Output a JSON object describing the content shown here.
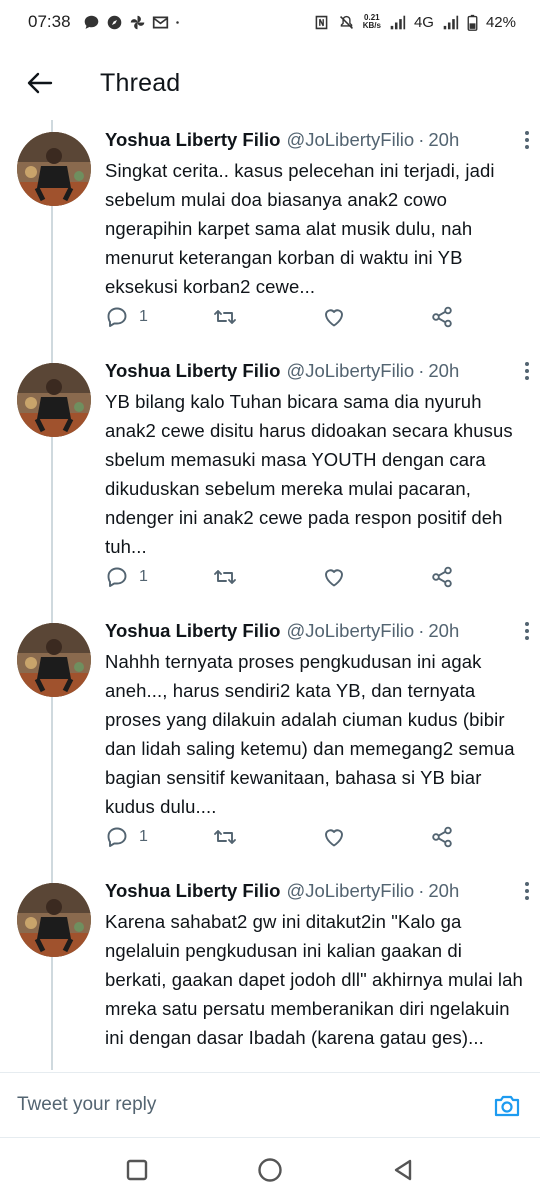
{
  "status_bar": {
    "time": "07:38",
    "net_speed_value": "0.21",
    "net_speed_unit": "KB/s",
    "network": "4G",
    "battery": "42%"
  },
  "header": {
    "title": "Thread"
  },
  "tweets": [
    {
      "name": "Yoshua Liberty Filio",
      "handle": "@JoLibertyFilio",
      "separator": "·",
      "time": "20h",
      "text": "Singkat cerita.. kasus pelecehan ini terjadi, jadi sebelum mulai doa biasanya anak2 cowo ngerapihin karpet sama alat musik dulu, nah menurut keterangan korban di waktu ini YB eksekusi korban2 cewe...",
      "replies": "1"
    },
    {
      "name": "Yoshua Liberty Filio",
      "handle": "@JoLibertyFilio",
      "separator": "·",
      "time": "20h",
      "text": "YB bilang kalo Tuhan bicara sama dia nyuruh anak2 cewe disitu harus didoakan secara khusus sbelum memasuki masa YOUTH dengan cara dikuduskan sebelum mereka mulai pacaran, ndenger ini anak2 cewe pada respon positif deh tuh...",
      "replies": "1"
    },
    {
      "name": "Yoshua Liberty Filio",
      "handle": "@JoLibertyFilio",
      "separator": "·",
      "time": "20h",
      "text": "Nahhh ternyata proses pengkudusan ini agak aneh..., harus sendiri2 kata YB, dan ternyata proses yang dilakuin adalah ciuman kudus (bibir dan lidah saling ketemu) dan memegang2 semua bagian sensitif kewanitaan, bahasa si YB biar kudus dulu....",
      "replies": "1"
    },
    {
      "name": "Yoshua Liberty Filio",
      "handle": "@JoLibertyFilio",
      "separator": "·",
      "time": "20h",
      "text": "Karena sahabat2 gw ini ditakut2in \"Kalo ga ngelaluin pengkudusan ini kalian gaakan di berkati, gaakan dapet jodoh dll\" akhirnya mulai lah mreka satu persatu memberanikan diri ngelakuin ini dengan dasar Ibadah (karena gatau ges)...",
      "replies": ""
    }
  ],
  "reply_bar": {
    "placeholder": "Tweet your reply"
  },
  "colors": {
    "accent": "#1d9bf0",
    "secondary_text": "#536471",
    "thread_line": "#cfd9de"
  },
  "icons": {
    "back": "arrow-left-icon",
    "more": "more-vertical-icon",
    "reply": "reply-icon",
    "retweet": "retweet-icon",
    "like": "heart-icon",
    "share": "share-icon",
    "camera": "camera-icon",
    "nav": [
      "recents-square-icon",
      "home-circle-icon",
      "back-triangle-icon"
    ]
  }
}
